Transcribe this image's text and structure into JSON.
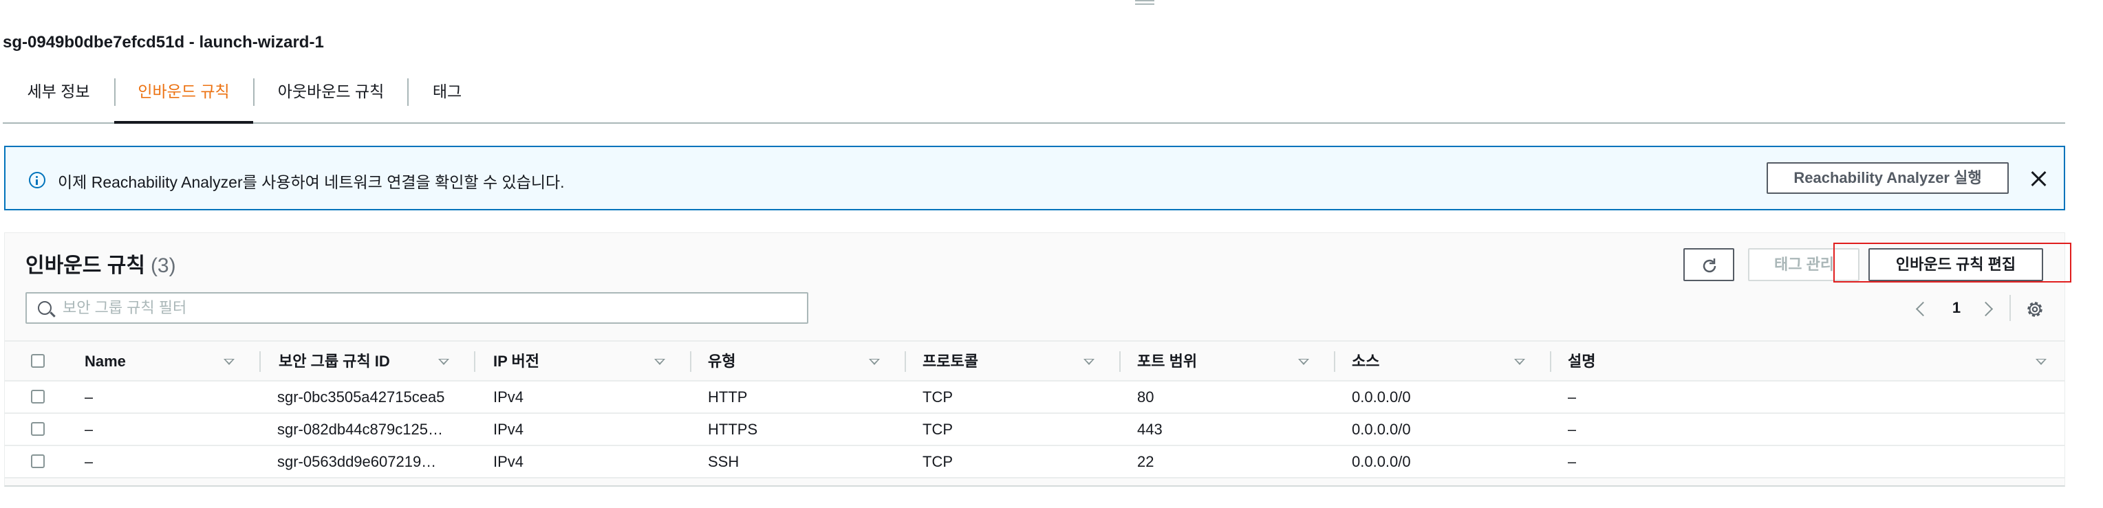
{
  "page_title": "sg-0949b0dbe7efcd51d - launch-wizard-1",
  "tabs": [
    {
      "label": "세부 정보",
      "active": false
    },
    {
      "label": "인바운드 규칙",
      "active": true
    },
    {
      "label": "아웃바운드 규칙",
      "active": false
    },
    {
      "label": "태그",
      "active": false
    }
  ],
  "flash": {
    "icon": "info-icon",
    "message": "이제 Reachability Analyzer를 사용하여 네트워크 연결을 확인할 수 있습니다.",
    "button_label": "Reachability Analyzer 실행",
    "close_icon": "close-icon"
  },
  "panel": {
    "title": "인바운드 규칙",
    "count": "(3)",
    "refresh_icon": "refresh-icon",
    "manage_tags_label": "태그 관리",
    "edit_label": "인바운드 규칙 편집",
    "search_placeholder": "보안 그룹 규칙 필터",
    "search_value": "",
    "page_number": "1"
  },
  "table": {
    "columns": [
      "Name",
      "보안 그룹 규칙 ID",
      "IP 버전",
      "유형",
      "프로토콜",
      "포트 범위",
      "소스",
      "설명"
    ],
    "rows": [
      [
        "–",
        "sgr-0bc3505a42715cea5",
        "IPv4",
        "HTTP",
        "TCP",
        "80",
        "0.0.0.0/0",
        "–"
      ],
      [
        "–",
        "sgr-082db44c879c125…",
        "IPv4",
        "HTTPS",
        "TCP",
        "443",
        "0.0.0.0/0",
        "–"
      ],
      [
        "–",
        "sgr-0563dd9e607219…",
        "IPv4",
        "SSH",
        "TCP",
        "22",
        "0.0.0.0/0",
        "–"
      ]
    ]
  },
  "colors": {
    "accent_orange": "#ec7211",
    "info_blue": "#0073bb",
    "highlight_red": "#e01e1e",
    "text": "#16191f"
  }
}
